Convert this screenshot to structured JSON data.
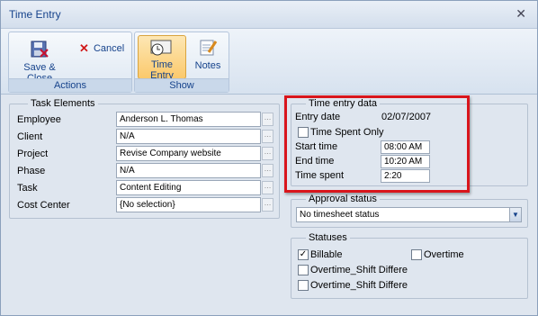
{
  "window": {
    "title": "Time Entry"
  },
  "ribbon": {
    "actions": {
      "label": "Actions",
      "save_close": "Save & Close",
      "cancel": "Cancel"
    },
    "show": {
      "label": "Show",
      "time_entry": "Time Entry",
      "notes": "Notes"
    }
  },
  "task_elements": {
    "legend": "Task Elements",
    "rows": [
      {
        "label": "Employee",
        "value": "Anderson L. Thomas"
      },
      {
        "label": "Client",
        "value": "N/A"
      },
      {
        "label": "Project",
        "value": "Revise Company website"
      },
      {
        "label": "Phase",
        "value": "N/A"
      },
      {
        "label": "Task",
        "value": "Content Editing"
      },
      {
        "label": "Cost Center",
        "value": "{No selection}"
      }
    ]
  },
  "time_entry_data": {
    "legend": "Time entry data",
    "entry_date_label": "Entry date",
    "entry_date_value": "02/07/2007",
    "time_spent_only": "Time Spent Only",
    "start_time_label": "Start time",
    "start_time_value": "08:00 AM",
    "end_time_label": "End time",
    "end_time_value": "10:20 AM",
    "time_spent_label": "Time spent",
    "time_spent_value": "2:20"
  },
  "approval": {
    "legend": "Approval status",
    "selected": "No timesheet status"
  },
  "statuses": {
    "legend": "Statuses",
    "billable": "Billable",
    "overtime": "Overtime",
    "ot_shift_1": "Overtime_Shift Differential",
    "ot_shift_2": "Overtime_Shift Differential"
  },
  "colors": {
    "highlight": "#d9151c",
    "accent": "#15428b"
  }
}
